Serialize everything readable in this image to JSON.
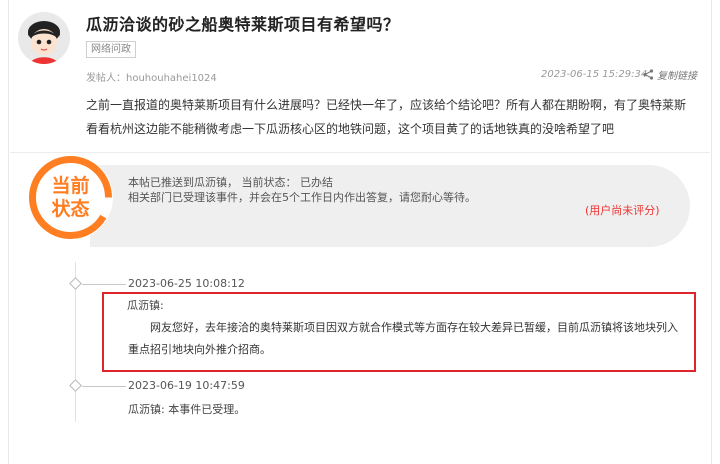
{
  "post": {
    "title": "瓜沥洽谈的砂之船奥特莱斯项目有希望吗？",
    "tag": "网络问政",
    "poster": "发帖人：houhouhahei1024",
    "time": "2023-06-15 15:29:34",
    "copy_link": "复制链接",
    "content": "之前一直报道的奥特莱斯项目有什么进展吗？已经快一年了，应该给个结论吧？所有人都在期盼啊，有了奥特莱斯看看杭州这边能不能稍微考虑一下瓜沥核心区的地铁问题，这个项目黄了的话地铁真的没啥希望了吧"
  },
  "status": {
    "badge_line1": "当前",
    "badge_line2": "状态",
    "message_line1": "本帖已推送到瓜沥镇， 当前状态： 已办结",
    "message_line2": "相关部门已受理该事件，并会在5个工作日内作出答复，请您耐心等待。",
    "rating": "(用户尚未评分)"
  },
  "timeline": [
    {
      "time": "2023-06-25 10:08:12",
      "author": "瓜沥镇:",
      "body": "网友您好，去年接洽的奥特莱斯项目因双方就合作模式等方面存在较大差异已暂缓，目前瓜沥镇将该地块列入重点招引地块向外推介招商。"
    },
    {
      "time": "2023-06-19 10:47:59",
      "text": "瓜沥镇: 本事件已受理。"
    }
  ],
  "colors": {
    "accent_orange": "#ff7e22",
    "highlight_red": "#e0242b",
    "rating_red": "#ee3333"
  },
  "icons": {
    "share": "share-icon",
    "avatar": "cartoon-avatar"
  }
}
